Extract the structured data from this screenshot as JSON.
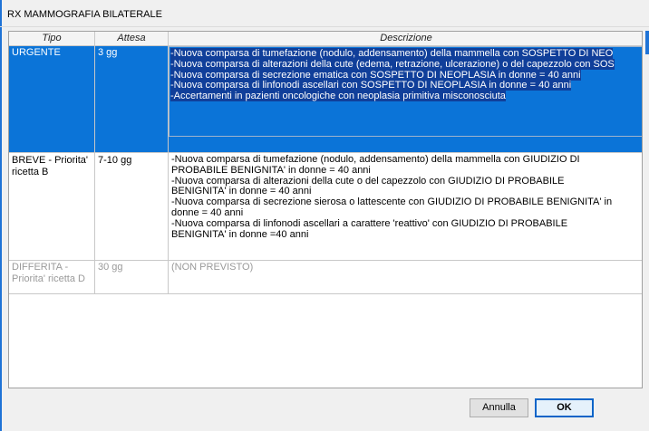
{
  "window": {
    "title": "RX MAMMOGRAFIA BILATERALE"
  },
  "table": {
    "headers": [
      "Tipo",
      "Attesa",
      "Descrizione"
    ],
    "rows": [
      {
        "tipo": "URGENTE",
        "attesa": "3 gg",
        "descrizione": [
          "-Nuova comparsa di tumefazione (nodulo, addensamento) della mammella con SOSPETTO DI NEO",
          "-Nuova comparsa di alterazioni della cute (edema, retrazione, ulcerazione) o del capezzolo con SOS",
          "-Nuova comparsa di secrezione ematica con SOSPETTO DI NEOPLASIA in donne = 40 anni",
          "-Nuova comparsa di linfonodi ascellari con SOSPETTO DI NEOPLASIA in donne = 40 anni",
          "-Accertamenti in pazienti oncologiche con neoplasia primitiva misconosciuta"
        ]
      },
      {
        "tipo": [
          "BREVE - Priorita'",
          "ricetta B"
        ],
        "attesa": "7-10 gg",
        "descrizione": [
          "-Nuova comparsa di tumefazione (nodulo, addensamento) della mammella con GIUDIZIO DI",
          "PROBABILE BENIGNITA' in donne = 40 anni",
          "-Nuova comparsa di alterazioni della cute o del capezzolo con GIUDIZIO DI PROBABILE",
          "BENIGNITA' in donne = 40 anni",
          "-Nuova comparsa di secrezione sierosa o lattescente con GIUDIZIO DI PROBABILE BENIGNITA' in",
          "donne = 40 anni",
          "-Nuova comparsa di linfonodi ascellari a carattere 'reattivo' con GIUDIZIO DI PROBABILE",
          "BENIGNITA' in donne =40 anni"
        ]
      },
      {
        "tipo": [
          "DIFFERITA -",
          "Priorita' ricetta D"
        ],
        "attesa": "30 gg",
        "descrizione": [
          "(NON PREVISTO)"
        ]
      }
    ]
  },
  "buttons": {
    "cancel": "Annulla",
    "ok": "OK"
  },
  "colors": {
    "selection": "#0b74d8",
    "accent": "#1f73d6"
  }
}
